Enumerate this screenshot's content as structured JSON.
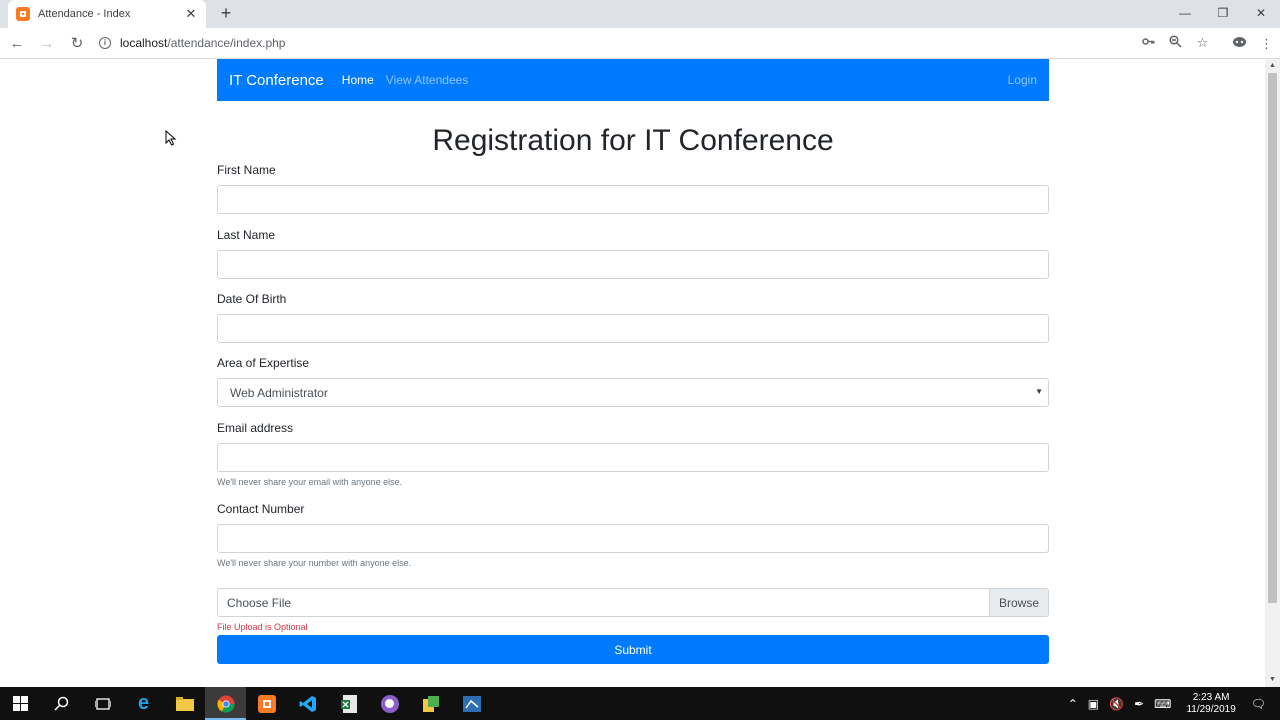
{
  "browser": {
    "tab_title": "Attendance - Index",
    "url_host": "localhost",
    "url_path": "/attendance/index.php"
  },
  "navbar": {
    "brand": "IT Conference",
    "links": [
      {
        "label": "Home",
        "active": true
      },
      {
        "label": "View Attendees",
        "active": false
      }
    ],
    "login": "Login"
  },
  "page": {
    "heading": "Registration for IT Conference"
  },
  "form": {
    "first_name_label": "First Name",
    "last_name_label": "Last Name",
    "dob_label": "Date Of Birth",
    "expertise_label": "Area of Expertise",
    "expertise_selected": "Web Administrator",
    "email_label": "Email address",
    "email_help": "We'll never share your email with anyone else.",
    "contact_label": "Contact Number",
    "contact_help": "We'll never share your number with anyone else.",
    "file_placeholder": "Choose File",
    "file_browse": "Browse",
    "file_help": "File Upload is Optional",
    "submit": "Submit"
  },
  "taskbar": {
    "time": "2:23 AM",
    "date": "11/29/2019"
  },
  "colors": {
    "primary": "#007bff",
    "error": "#dc3545",
    "taskbar": "#101010"
  }
}
